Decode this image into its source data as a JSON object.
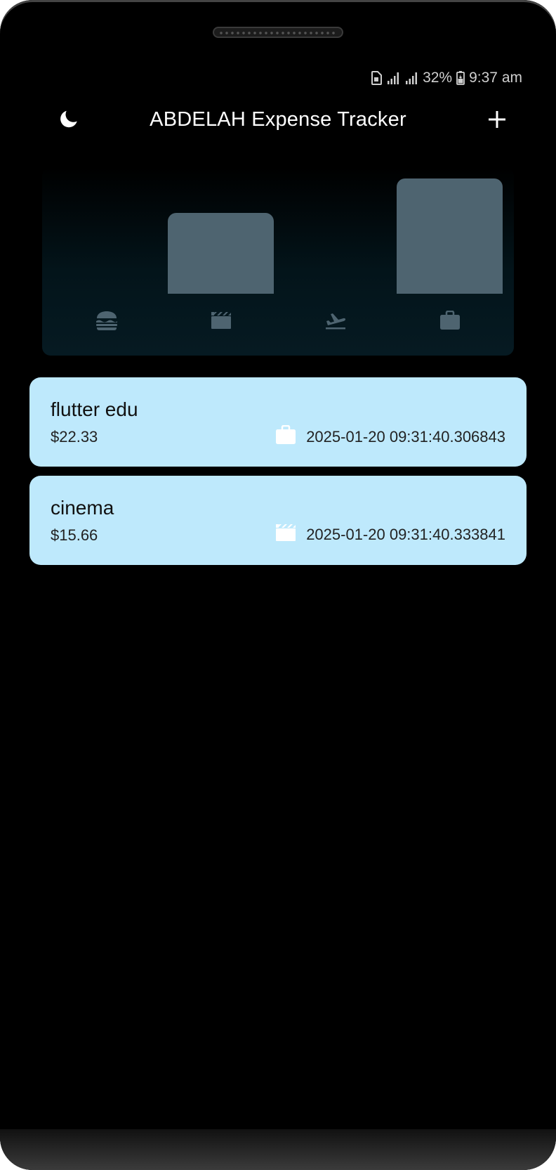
{
  "status_bar": {
    "battery": "32%",
    "time": "9:37 am",
    "icons": [
      "sim-icon",
      "signal-icon",
      "signal-icon",
      "battery-icon"
    ]
  },
  "app_bar": {
    "title": "ABDELAH Expense Tracker",
    "left_icon": "moon-icon",
    "right_icon": "plus-icon"
  },
  "chart_data": {
    "type": "bar",
    "categories": [
      "food",
      "leisure",
      "travel",
      "work"
    ],
    "category_icons": [
      "burger-icon",
      "movie-icon",
      "flight-icon",
      "briefcase-icon"
    ],
    "values": [
      0,
      15.66,
      0,
      22.33
    ],
    "ylim": [
      0,
      22.33
    ],
    "grid": false,
    "bar_color": "#4e6470"
  },
  "expenses": [
    {
      "title": "flutter edu",
      "amount": "$22.33",
      "category_icon": "briefcase-icon",
      "date": "2025-01-20 09:31:40.306843"
    },
    {
      "title": "cinema",
      "amount": "$15.66",
      "category_icon": "movie-icon",
      "date": "2025-01-20 09:31:40.333841"
    }
  ],
  "colors": {
    "background": "#000000",
    "card": "#bee9fc",
    "bar": "#4e6470",
    "chart_icon": "#4e6470",
    "text_on_card": "#111111"
  }
}
